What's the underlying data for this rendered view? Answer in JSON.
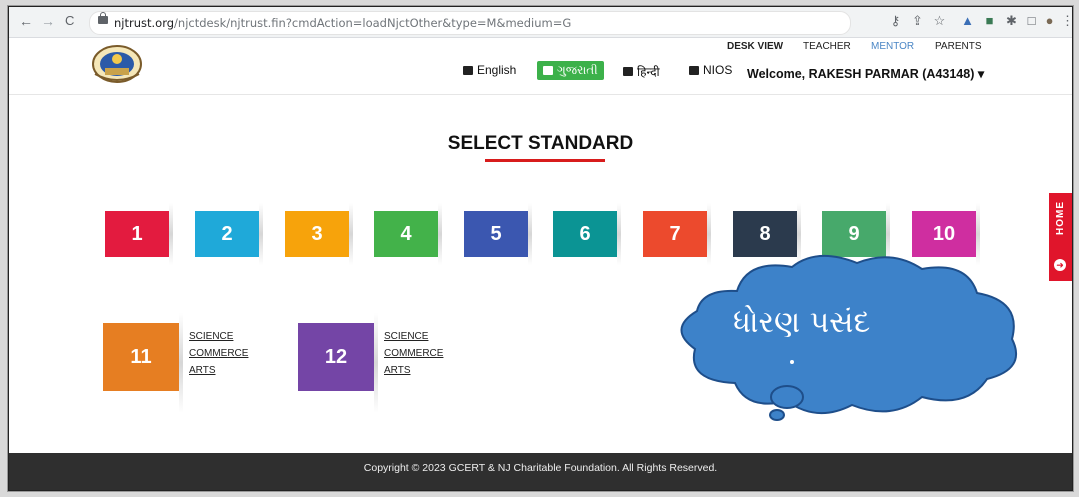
{
  "browser": {
    "url_host": "njtrust.org",
    "url_path": "/njctdesk/njtrust.fin?cmdAction=loadNjctOther&type=M&medium=G",
    "back": "←",
    "forward": "→",
    "reload": "C"
  },
  "header": {
    "top_links": [
      "DESK VIEW",
      "TEACHER",
      "MENTOR",
      "PARENTS"
    ],
    "languages": [
      "English",
      "ગુજરાતી",
      "हिन्दी",
      "NIOS"
    ],
    "active_language": "ગુજરાતી",
    "welcome": "Welcome, RAKESH PARMAR (A43148)",
    "dropdown_caret": "▾"
  },
  "main": {
    "title": "SELECT STANDARD",
    "standards": [
      {
        "label": "1",
        "color": "#e31b3f"
      },
      {
        "label": "2",
        "color": "#1fa9d9"
      },
      {
        "label": "3",
        "color": "#f7a30b"
      },
      {
        "label": "4",
        "color": "#43b24a"
      },
      {
        "label": "5",
        "color": "#3b57b0"
      },
      {
        "label": "6",
        "color": "#0b9494"
      },
      {
        "label": "7",
        "color": "#ec4a2d"
      },
      {
        "label": "8",
        "color": "#2b3a4d"
      },
      {
        "label": "9",
        "color": "#47a96b"
      },
      {
        "label": "10",
        "color": "#cf2ea0"
      }
    ],
    "higher": [
      {
        "label": "11",
        "color": "#e67e22",
        "streams": [
          "SCIENCE",
          "COMMERCE",
          "ARTS"
        ]
      },
      {
        "label": "12",
        "color": "#7445a6",
        "streams": [
          "SCIENCE",
          "COMMERCE",
          "ARTS"
        ]
      }
    ]
  },
  "side": {
    "home_label": "HOME",
    "home_icon": "arrow-circle-icon"
  },
  "callout": {
    "text": "ધોરણ પસંદ",
    "color": "#3d82c9"
  },
  "footer": {
    "copyright": "Copyright © 2023 GCERT & NJ Charitable Foundation. All Rights Reserved."
  }
}
